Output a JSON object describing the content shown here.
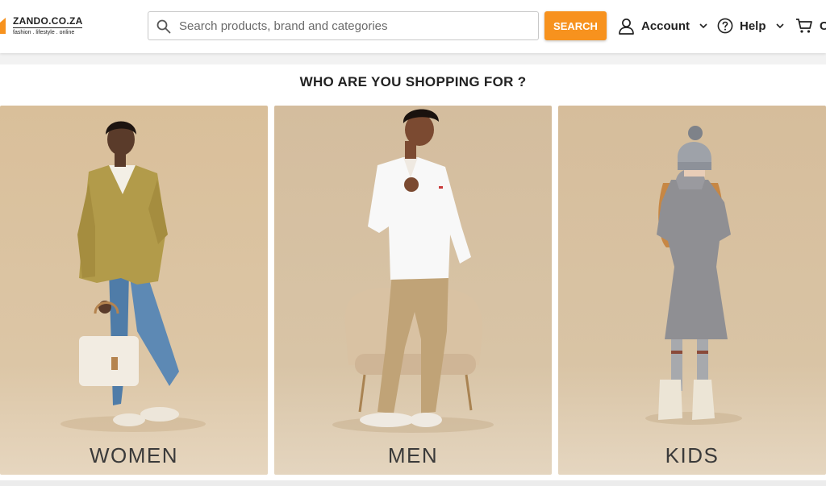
{
  "brand": {
    "name": "ZANDO.CO.ZA",
    "tagline": "fashion . lifestyle . online",
    "accent": "#f7921e"
  },
  "search": {
    "placeholder": "Search products, brand and categories",
    "button_label": "SEARCH"
  },
  "nav": {
    "account_label": "Account",
    "help_label": "Help",
    "cart_label": "C"
  },
  "section": {
    "heading": "WHO ARE YOU SHOPPING FOR ?"
  },
  "categories": [
    {
      "label": "WOMEN"
    },
    {
      "label": "MEN"
    },
    {
      "label": "KIDS"
    }
  ]
}
